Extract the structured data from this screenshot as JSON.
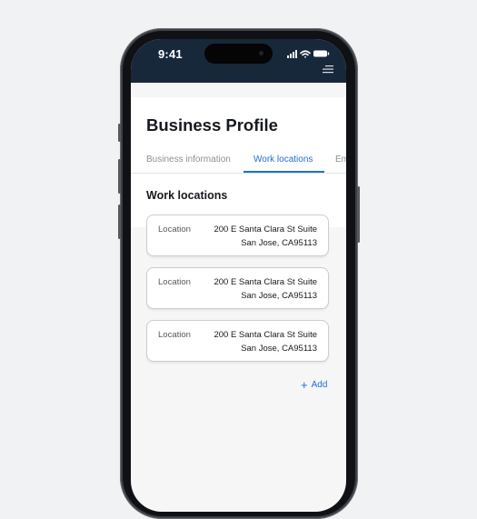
{
  "status_bar": {
    "time": "9:41",
    "icons": [
      "cellular-signal-icon",
      "wifi-icon",
      "battery-icon"
    ]
  },
  "header": {
    "menu_icon": "menu-icon",
    "background_color": "#18283b"
  },
  "page": {
    "title": "Business Profile"
  },
  "tabs": [
    {
      "label": "Business information",
      "active": false
    },
    {
      "label": "Work locations",
      "active": true
    },
    {
      "label": "Em",
      "active": false
    }
  ],
  "section": {
    "title": "Work locations"
  },
  "locations": [
    {
      "label": "Location",
      "line1": "200 E Santa Clara St Suite",
      "line2": "San Jose, CA95113"
    },
    {
      "label": "Location",
      "line1": "200 E Santa Clara St Suite",
      "line2": "San Jose, CA95113"
    },
    {
      "label": "Location",
      "line1": "200 E Santa Clara St Suite",
      "line2": "San Jose, CA95113"
    }
  ],
  "actions": {
    "add_label": "Add",
    "add_icon": "plus-icon"
  },
  "colors": {
    "accent": "#1f6fd4",
    "text_primary": "#16191d",
    "text_secondary": "#8b9097",
    "page_background": "#f1f2f4"
  }
}
